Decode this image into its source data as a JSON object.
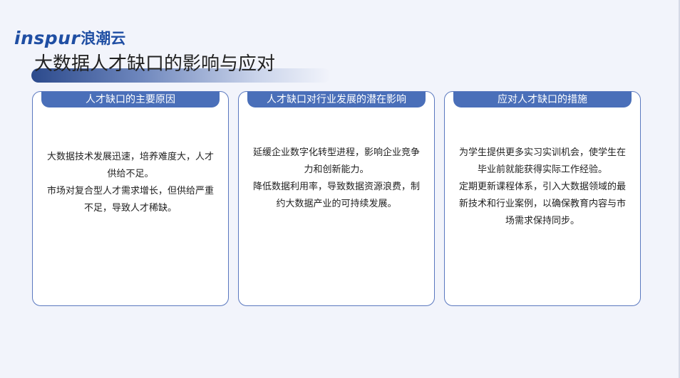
{
  "logo": {
    "en": "inspur",
    "cn": "浪潮云"
  },
  "title": "大数据人才缺口的影响与应对",
  "cards": [
    {
      "header": "人才缺口的主要原因",
      "paragraphs": [
        "大数据技术发展迅速，培养难度大，人才供给不足。",
        "市场对复合型人才需求增长，但供给严重不足，导致人才稀缺。"
      ]
    },
    {
      "header": "人才缺口对行业发展的潜在影响",
      "paragraphs": [
        "延缓企业数字化转型进程，影响企业竞争力和创新能力。",
        "降低数据利用率，导致数据资源浪费，制约大数据产业的可持续发展。"
      ]
    },
    {
      "header": "应对人才缺口的措施",
      "paragraphs": [
        "为学生提供更多实习实训机会，使学生在毕业前就能获得实际工作经验。",
        "定期更新课程体系，引入大数据领域的最新技术和行业案例，以确保教育内容与市场需求保持同步。"
      ]
    }
  ],
  "colors": {
    "accent": "#4a6fb9",
    "border": "#5a78bf",
    "logo": "#1f4ea3",
    "background": "#f2f4fb"
  }
}
